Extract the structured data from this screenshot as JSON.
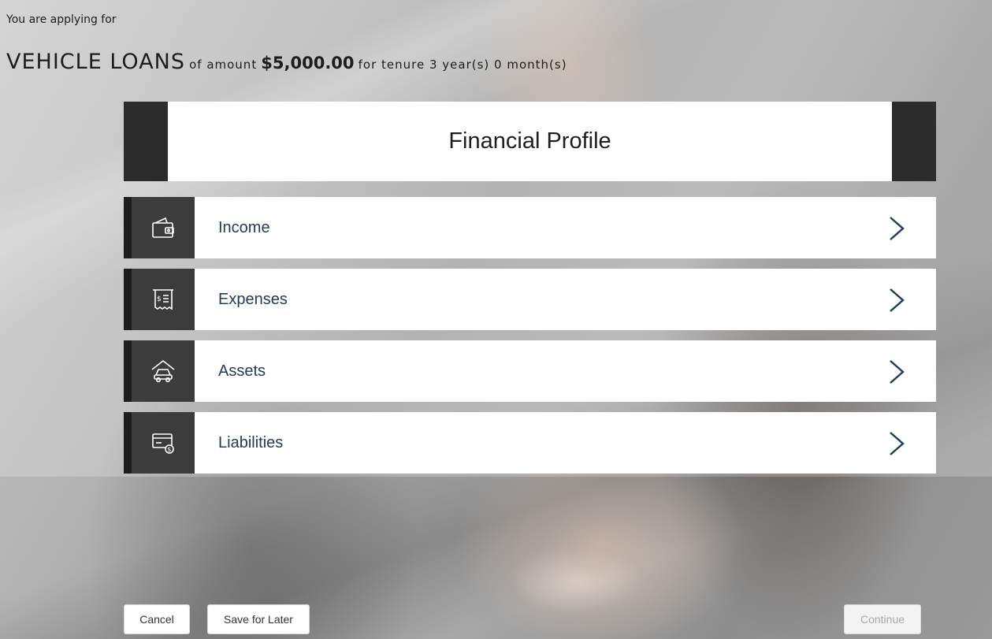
{
  "header": {
    "applying_text": "You are applying for",
    "loan_type": "VEHICLE LOANS",
    "of_amount_text": "of amount",
    "amount": "$5,000.00",
    "tenure_text": "for tenure 3 year(s) 0 month(s)"
  },
  "section": {
    "title": "Financial Profile"
  },
  "items": [
    {
      "label": "Income",
      "icon": "wallet-icon"
    },
    {
      "label": "Expenses",
      "icon": "receipt-icon"
    },
    {
      "label": "Assets",
      "icon": "house-car-icon"
    },
    {
      "label": "Liabilities",
      "icon": "card-dollar-icon"
    }
  ],
  "buttons": {
    "cancel": "Cancel",
    "save_for_later": "Save for Later",
    "continue": "Continue"
  },
  "colors": {
    "header_bar": "#2c2c2c",
    "icon_box": "#3c3c3c",
    "item_label": "#233b57"
  }
}
